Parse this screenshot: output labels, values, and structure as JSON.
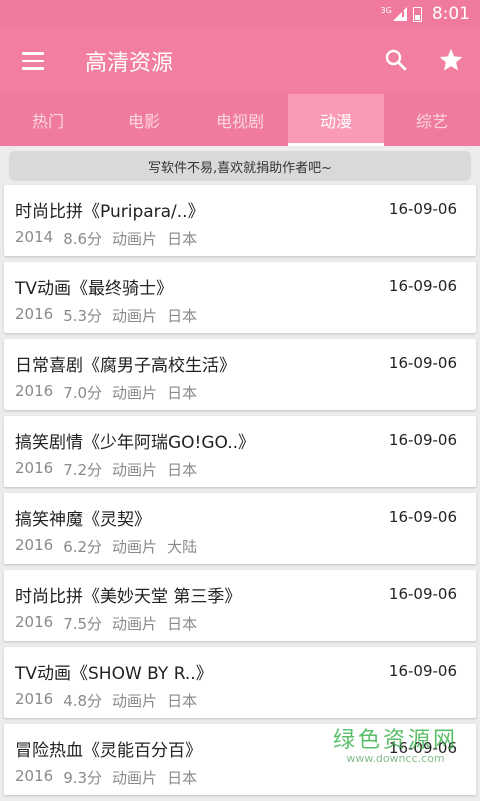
{
  "status_bar": {
    "network": "3G",
    "time": "8:01"
  },
  "appbar": {
    "title": "高清资源",
    "menu_icon": "hamburger-menu-icon",
    "search_icon": "search-icon",
    "favorite_icon": "star-icon"
  },
  "tabs": [
    {
      "label": "热门",
      "active": false
    },
    {
      "label": "电影",
      "active": false
    },
    {
      "label": "电视剧",
      "active": false
    },
    {
      "label": "动漫",
      "active": true
    },
    {
      "label": "综艺",
      "active": false
    }
  ],
  "donate_text": "写软件不易,喜欢就捐助作者吧~",
  "items": [
    {
      "title": "时尚比拼《Puripara/..》",
      "date": "16-09-06",
      "year": "2014",
      "score": "8.6分",
      "type": "动画片",
      "region": "日本"
    },
    {
      "title": "TV动画《最终骑士》",
      "date": "16-09-06",
      "year": "2016",
      "score": "5.3分",
      "type": "动画片",
      "region": "日本"
    },
    {
      "title": "日常喜剧《腐男子高校生活》",
      "date": "16-09-06",
      "year": "2016",
      "score": "7.0分",
      "type": "动画片",
      "region": "日本"
    },
    {
      "title": "搞笑剧情《少年阿瑞GO!GO..》",
      "date": "16-09-06",
      "year": "2016",
      "score": "7.2分",
      "type": "动画片",
      "region": "日本"
    },
    {
      "title": "搞笑神魔《灵契》",
      "date": "16-09-06",
      "year": "2016",
      "score": "6.2分",
      "type": "动画片",
      "region": "大陆"
    },
    {
      "title": "时尚比拼《美妙天堂 第三季》",
      "date": "16-09-06",
      "year": "2016",
      "score": "7.5分",
      "type": "动画片",
      "region": "日本"
    },
    {
      "title": "TV动画《SHOW BY R..》",
      "date": "16-09-06",
      "year": "2016",
      "score": "4.8分",
      "type": "动画片",
      "region": "日本"
    },
    {
      "title": "冒险热血《灵能百分百》",
      "date": "16-09-06",
      "year": "2016",
      "score": "9.3分",
      "type": "动画片",
      "region": "日本"
    }
  ],
  "watermark": {
    "cn": "绿色资源网",
    "url": "www.downcc.com"
  },
  "colors": {
    "primary": "#f27ea0",
    "tab_active": "#f99ab6",
    "watermark": "#3fb34f"
  }
}
